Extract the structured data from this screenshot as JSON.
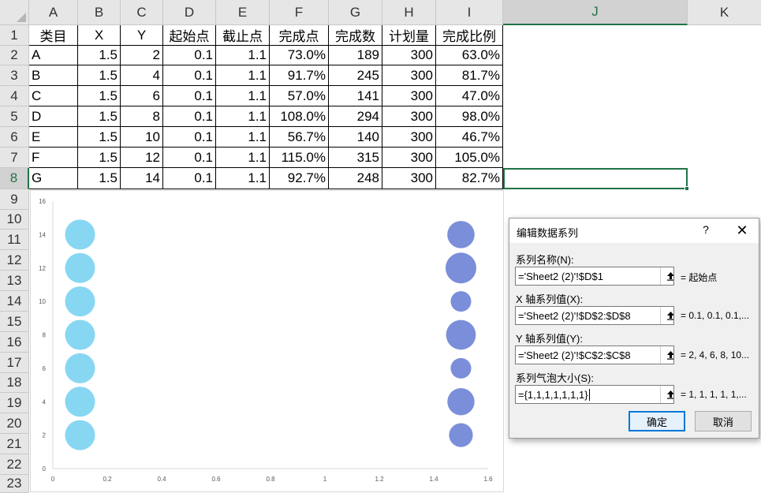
{
  "columns": [
    "A",
    "B",
    "C",
    "D",
    "E",
    "F",
    "G",
    "H",
    "I",
    "J",
    "K"
  ],
  "active_column": "J",
  "rows": [
    "1",
    "2",
    "3",
    "4",
    "5",
    "6",
    "7",
    "8",
    "9",
    "10",
    "11",
    "12",
    "13",
    "14",
    "15",
    "16",
    "17",
    "18",
    "19",
    "20",
    "21",
    "22",
    "23"
  ],
  "active_row": "8",
  "table_header": [
    "类目",
    "X",
    "Y",
    "起始点",
    "截止点",
    "完成点",
    "完成数",
    "计划量",
    "完成比例"
  ],
  "table_rows": [
    [
      "A",
      "1.5",
      "2",
      "0.1",
      "1.1",
      "73.0%",
      "189",
      "300",
      "63.0%"
    ],
    [
      "B",
      "1.5",
      "4",
      "0.1",
      "1.1",
      "91.7%",
      "245",
      "300",
      "81.7%"
    ],
    [
      "C",
      "1.5",
      "6",
      "0.1",
      "1.1",
      "57.0%",
      "141",
      "300",
      "47.0%"
    ],
    [
      "D",
      "1.5",
      "8",
      "0.1",
      "1.1",
      "108.0%",
      "294",
      "300",
      "98.0%"
    ],
    [
      "E",
      "1.5",
      "10",
      "0.1",
      "1.1",
      "56.7%",
      "140",
      "300",
      "46.7%"
    ],
    [
      "F",
      "1.5",
      "12",
      "0.1",
      "1.1",
      "115.0%",
      "315",
      "300",
      "105.0%"
    ],
    [
      "G",
      "1.5",
      "14",
      "0.1",
      "1.1",
      "92.7%",
      "248",
      "300",
      "82.7%"
    ]
  ],
  "chart_data": {
    "type": "scatter",
    "subtype": "bubble",
    "title": "",
    "xlabel": "",
    "ylabel": "",
    "xlim": [
      0,
      1.6
    ],
    "ylim": [
      0,
      16
    ],
    "x_ticks": [
      "0",
      "0.2",
      "0.4",
      "0.6",
      "0.8",
      "1",
      "1.2",
      "1.4",
      "1.6"
    ],
    "y_ticks": [
      "0",
      "2",
      "4",
      "6",
      "8",
      "10",
      "12",
      "14",
      "16"
    ],
    "grid": false,
    "series": [
      {
        "color": "#87d7f3",
        "points": [
          {
            "x": 0.1,
            "y": 2,
            "size": 1
          },
          {
            "x": 0.1,
            "y": 4,
            "size": 1
          },
          {
            "x": 0.1,
            "y": 6,
            "size": 1
          },
          {
            "x": 0.1,
            "y": 8,
            "size": 1
          },
          {
            "x": 0.1,
            "y": 10,
            "size": 1
          },
          {
            "x": 0.1,
            "y": 12,
            "size": 1
          },
          {
            "x": 0.1,
            "y": 14,
            "size": 1
          }
        ]
      },
      {
        "color": "#7b8ed9",
        "points": [
          {
            "x": 1.5,
            "y": 2,
            "size": 0.63
          },
          {
            "x": 1.5,
            "y": 4,
            "size": 0.817
          },
          {
            "x": 1.5,
            "y": 6,
            "size": 0.47
          },
          {
            "x": 1.5,
            "y": 8,
            "size": 0.98
          },
          {
            "x": 1.5,
            "y": 10,
            "size": 0.467
          },
          {
            "x": 1.5,
            "y": 12,
            "size": 1.05
          },
          {
            "x": 1.5,
            "y": 14,
            "size": 0.827
          }
        ]
      }
    ]
  },
  "dialog": {
    "title": "编辑数据系列",
    "help": "?",
    "close": "✕",
    "series_name_label": "系列名称(N):",
    "series_name_value": "='Sheet2 (2)'!$D$1",
    "series_name_preview": "= 起始点",
    "x_values_label": "X 轴系列值(X):",
    "x_values_value": "='Sheet2 (2)'!$D$2:$D$8",
    "x_values_preview": "= 0.1, 0.1, 0.1,...",
    "y_values_label": "Y 轴系列值(Y):",
    "y_values_value": "='Sheet2 (2)'!$C$2:$C$8",
    "y_values_preview": "= 2, 4, 6, 8, 10...",
    "bubble_size_label": "系列气泡大小(S):",
    "bubble_size_value": "={1,1,1,1,1,1,1}",
    "bubble_size_preview": "= 1, 1, 1, 1, 1,...",
    "ok_label": "确定",
    "cancel_label": "取消"
  },
  "colors": {
    "accent": "#217346",
    "series1": "#87d7f3",
    "series2": "#7b8ed9",
    "dialog_default_border": "#0078d7"
  }
}
